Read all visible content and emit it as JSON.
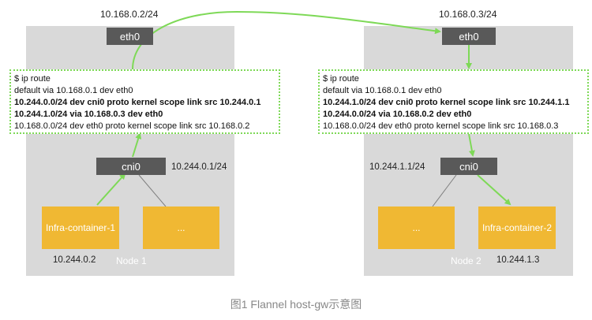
{
  "left_node": {
    "eth0_ip": "10.168.0.2/24",
    "eth0_label": "eth0",
    "route_lines": [
      "$ ip route",
      "default via 10.168.0.1 dev eth0",
      "10.244.0.0/24 dev cni0 proto kernel scope link src 10.244.0.1",
      "10.244.1.0/24 via 10.168.0.3 dev eth0",
      "10.168.0.0/24 dev eth0 proto kernel scope link src 10.168.0.2"
    ],
    "cni0_label": "cni0",
    "cni0_ip": "10.244.0.1/24",
    "container_label": "Infra-container-1",
    "other_label": "...",
    "container_ip": "10.244.0.2",
    "node_label": "Node 1"
  },
  "right_node": {
    "eth0_ip": "10.168.0.3/24",
    "eth0_label": "eth0",
    "route_lines": [
      "$ ip route",
      "default via 10.168.0.1 dev eth0",
      "10.244.1.0/24 dev cni0 proto kernel scope link src 10.244.1.1",
      "10.244.0.0/24 via 10.168.0.2 dev eth0",
      "10.168.0.0/24 dev eth0 proto kernel scope link src 10.168.0.3"
    ],
    "cni0_label": "cni0",
    "cni0_ip": "10.244.1.1/24",
    "container_label": "Infra-container-2",
    "other_label": "...",
    "container_ip": "10.244.1.3",
    "node_label": "Node 2"
  },
  "caption": "图1 Flannel host-gw示意图",
  "colors": {
    "node_bg": "#d9d9d9",
    "device_bg": "#595959",
    "container": "#f0b833",
    "arrow": "#7ed957",
    "link": "#7f7f7f"
  }
}
